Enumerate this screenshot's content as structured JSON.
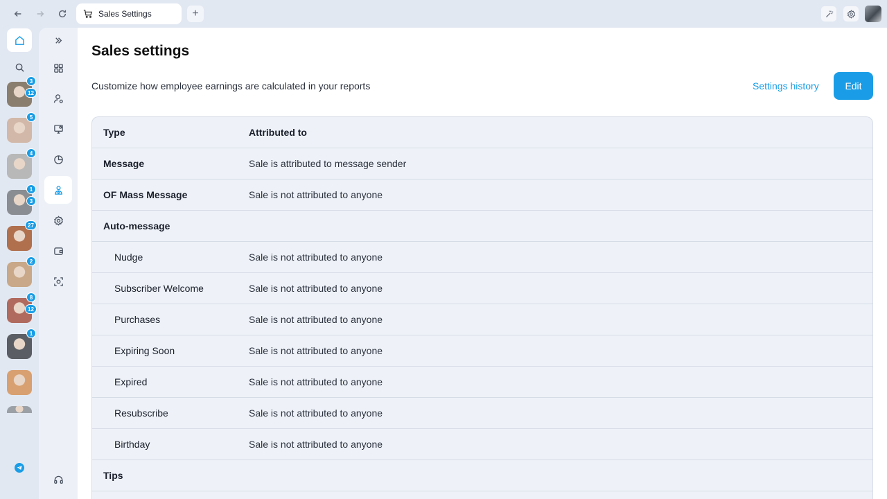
{
  "browser": {
    "tab_title": "Sales Settings",
    "new_tab": "+"
  },
  "rail": {
    "creators": [
      {
        "badges": [
          "3",
          "12"
        ],
        "color": "#8a7e6e"
      },
      {
        "badges": [
          "5"
        ],
        "color": "#d2b8a8"
      },
      {
        "badges": [
          "4"
        ],
        "color": "#b8b8b8"
      },
      {
        "badges": [
          "1",
          "3"
        ],
        "color": "#8a8e92"
      },
      {
        "badges": [
          "27"
        ],
        "color": "#b0704e"
      },
      {
        "badges": [
          "2"
        ],
        "color": "#c8a888"
      },
      {
        "badges": [
          "8",
          "12"
        ],
        "color": "#b06a5e"
      },
      {
        "badges": [
          "1"
        ],
        "color": "#5a5e64"
      },
      {
        "badges": [],
        "color": "#d8a070"
      },
      {
        "badges": [],
        "color": "#9aa0a6"
      }
    ]
  },
  "page": {
    "title": "Sales settings",
    "subtitle": "Customize how employee earnings are calculated in your reports",
    "history_link": "Settings history",
    "edit_label": "Edit"
  },
  "table": {
    "headers": [
      "Type",
      "Attributed to"
    ],
    "rows": [
      {
        "type": "Message",
        "attributed": "Sale is attributed to message sender",
        "kind": "group"
      },
      {
        "type": "OF Mass Message",
        "attributed": "Sale is not attributed to anyone",
        "kind": "group"
      },
      {
        "type": "Auto-message",
        "attributed": "",
        "kind": "group"
      },
      {
        "type": "Nudge",
        "attributed": "Sale is not attributed to anyone",
        "kind": "sub"
      },
      {
        "type": "Subscriber Welcome",
        "attributed": "Sale is not attributed to anyone",
        "kind": "sub"
      },
      {
        "type": "Purchases",
        "attributed": "Sale is not attributed to anyone",
        "kind": "sub"
      },
      {
        "type": "Expiring Soon",
        "attributed": "Sale is not attributed to anyone",
        "kind": "sub"
      },
      {
        "type": "Expired",
        "attributed": "Sale is not attributed to anyone",
        "kind": "sub"
      },
      {
        "type": "Resubscribe",
        "attributed": "Sale is not attributed to anyone",
        "kind": "sub"
      },
      {
        "type": "Birthday",
        "attributed": "Sale is not attributed to anyone",
        "kind": "sub"
      },
      {
        "type": "Tips",
        "attributed": "",
        "kind": "group"
      }
    ]
  },
  "colors": {
    "accent": "#1a9de6",
    "page_bg": "#e2e8f2",
    "table_bg": "#eef2f8"
  }
}
